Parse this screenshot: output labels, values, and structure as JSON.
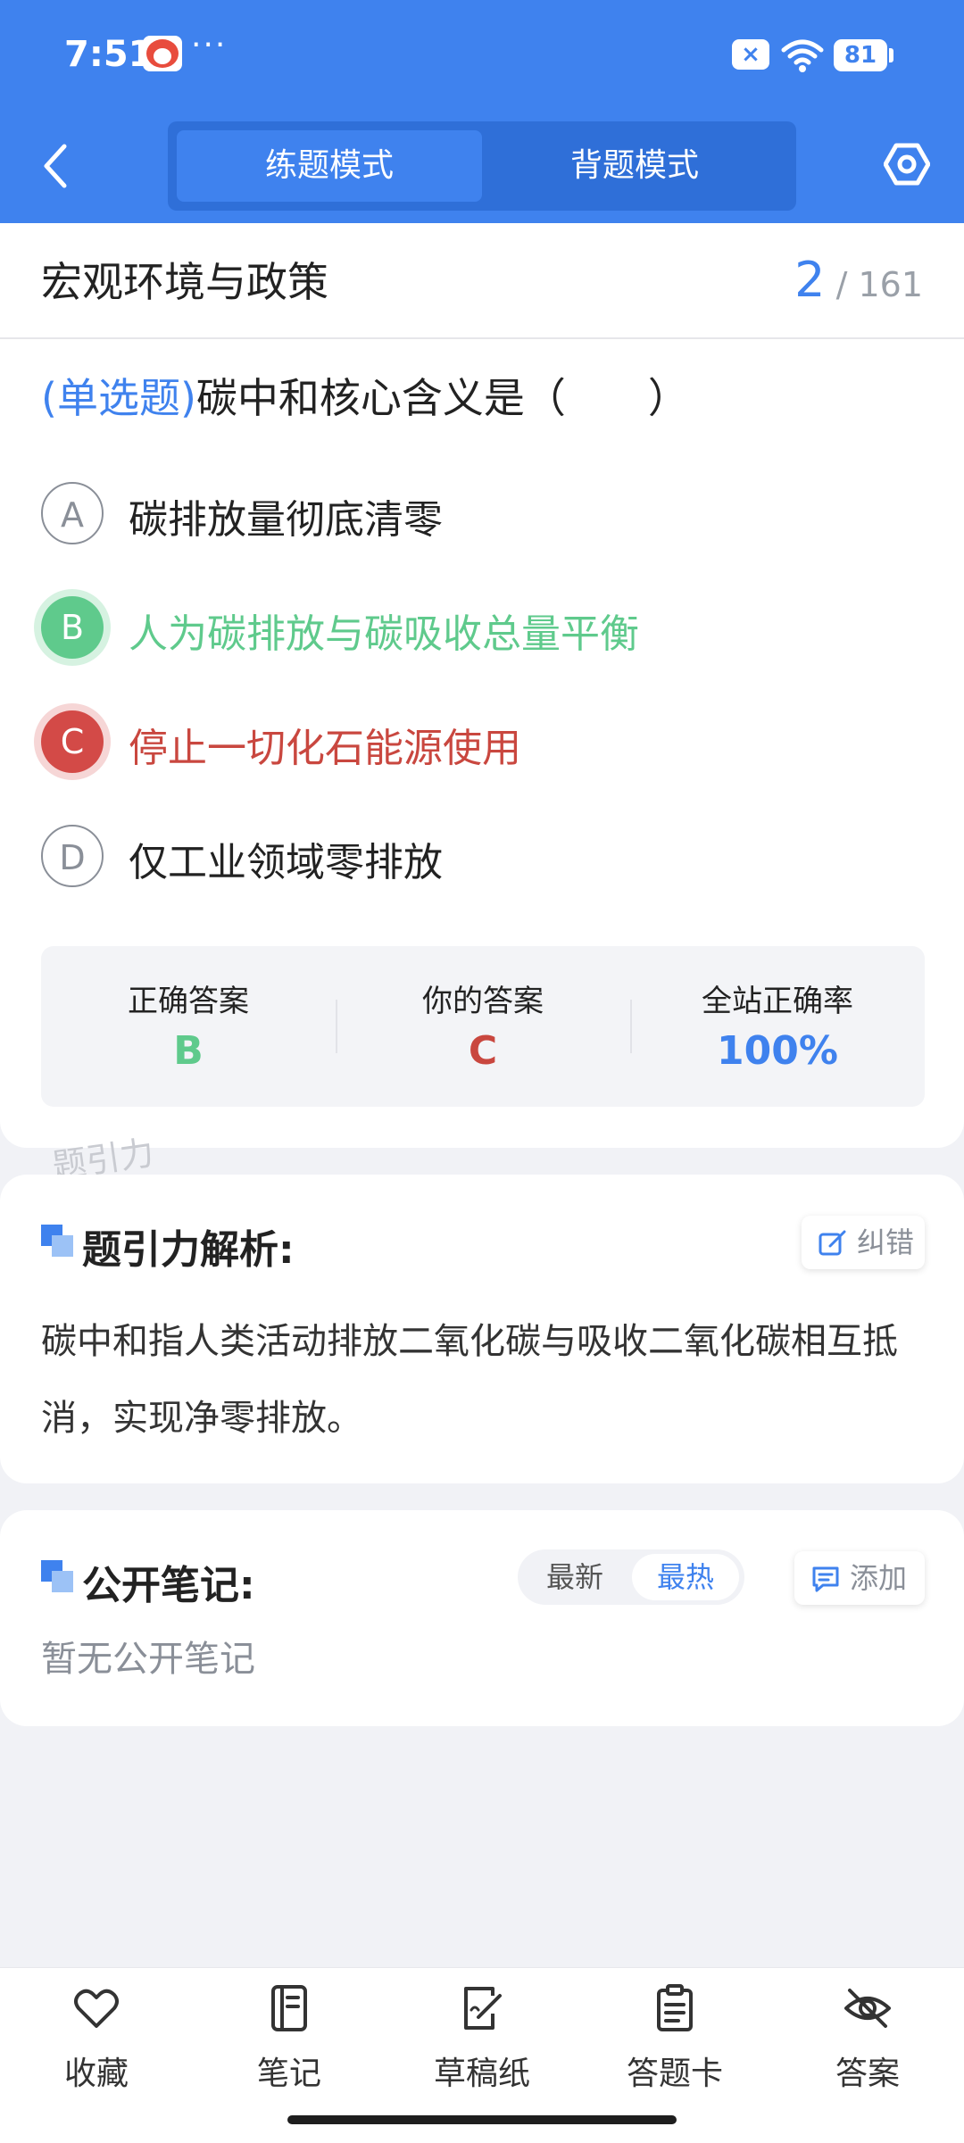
{
  "status": {
    "time": "7:51",
    "dots": "···",
    "battery": "81",
    "notif_badge": "×"
  },
  "header": {
    "modes": [
      "练题模式",
      "背题模式"
    ],
    "active_mode": "练题模式"
  },
  "question": {
    "category": "宏观环境与政策",
    "index": "2",
    "total": "161",
    "type": "(单选题)",
    "text": "碳中和核心含义是（　　）",
    "options": [
      {
        "letter": "A",
        "text": "碳排放量彻底清零",
        "state": "normal"
      },
      {
        "letter": "B",
        "text": "人为碳排放与碳吸收总量平衡",
        "state": "correct"
      },
      {
        "letter": "C",
        "text": "停止一切化石能源使用",
        "state": "wrong"
      },
      {
        "letter": "D",
        "text": "仅工业领域零排放",
        "state": "normal"
      }
    ]
  },
  "stats": [
    {
      "label": "正确答案",
      "value": "B",
      "color": "#5fca8c"
    },
    {
      "label": "你的答案",
      "value": "C",
      "color": "#c9473f"
    },
    {
      "label": "全站正确率",
      "value": "100%",
      "color": "#3f82ee"
    }
  ],
  "watermark": "题引力",
  "analysis": {
    "title": "题引力解析:",
    "report_label": "纠错",
    "text": "碳中和指人类活动排放二氧化碳与吸收二氧化碳相互抵消，实现净零排放。"
  },
  "notes": {
    "title": "公开笔记:",
    "sort_options": [
      "最新",
      "最热"
    ],
    "active_sort": "最热",
    "add_label": "添加",
    "empty_text": "暂无公开笔记"
  },
  "bottom_nav": [
    {
      "label": "收藏",
      "icon": "heart-icon"
    },
    {
      "label": "笔记",
      "icon": "notebook-icon"
    },
    {
      "label": "草稿纸",
      "icon": "draft-paper-icon"
    },
    {
      "label": "答题卡",
      "icon": "answer-card-icon"
    },
    {
      "label": "答案",
      "icon": "eye-off-icon"
    }
  ],
  "colors": {
    "primary": "#3f82ee",
    "correct": "#5fca8c",
    "wrong": "#c9473f"
  }
}
